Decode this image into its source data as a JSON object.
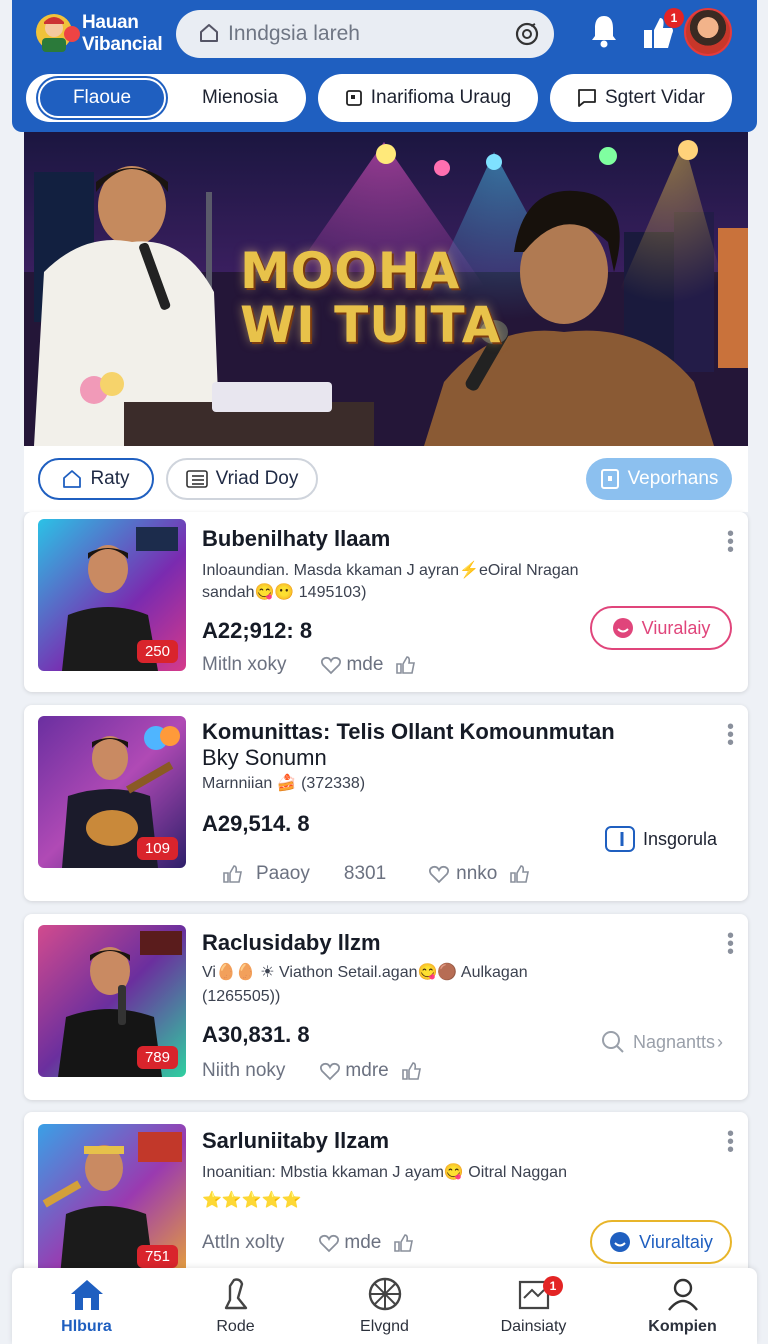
{
  "header": {
    "brand_line1": "Hauan",
    "brand_line2": "Vibancial",
    "search_placeholder": "Inndgsia lareh",
    "messages_badge": "1",
    "segment": {
      "active": "Flaoue",
      "inactive": "Mienosia"
    },
    "pills": [
      "Inarifioma Uraug",
      "Sgtert Vidar"
    ]
  },
  "hero": {
    "title_line1": "MOOHA",
    "title_line2": "WI TUITA"
  },
  "filters": {
    "chip1": "Raty",
    "chip2": "Vriad Doy",
    "chip3": "Veporhans"
  },
  "cards": [
    {
      "title": "Bubenilhaty llaam",
      "desc_line1": "Inloaundian. Masda kkaman J ayran⚡eOiral Nragan",
      "desc_line2": "sandah😋😶 1495103)",
      "price": "A22;912: 8",
      "meta1": "Mitln xoky",
      "meta2": "mde",
      "count": "250",
      "action": "Viuralaiy"
    },
    {
      "title_line1": "Komunittas: Telis Ollant Komounmutan",
      "title_line2": "Bky Sonumn",
      "desc_line1": "Marnniian 🍰 (372338)",
      "price": "A29,514. 8",
      "meta0": "Paaoy",
      "meta1": "8301",
      "meta2": "nnko",
      "count": "109",
      "action": "Insgorula"
    },
    {
      "title": "Raclusidaby llzm",
      "desc_line1": "Vi🥚🥚 ☀ Viathon Setail.agan😋🟤 Aulkagan",
      "desc_line2": "(1265505))",
      "price": "A30,831. 8",
      "meta1": "Niith noky",
      "meta2": "mdre",
      "count": "789",
      "action": "Nagnantts"
    },
    {
      "title": "Sarluniitaby llzam",
      "desc_line1": "Inoanitian: Mbstia kkaman J ayam😋 Oitral Naggan",
      "desc_line2": "⭐⭐⭐⭐⭐",
      "meta1": "Attln xolty",
      "meta2": "mde",
      "count": "751",
      "action": "Viuraltaiy"
    }
  ],
  "bottom_nav": [
    {
      "label": "Hlbura"
    },
    {
      "label": "Rode"
    },
    {
      "label": "Elvgnd"
    },
    {
      "label": "Dainsiaty",
      "badge": "1"
    },
    {
      "label": "Kompien"
    }
  ],
  "colors": {
    "brand": "#1f5fc0",
    "accent_pink": "#e0457b",
    "badge_red": "#e32424"
  }
}
